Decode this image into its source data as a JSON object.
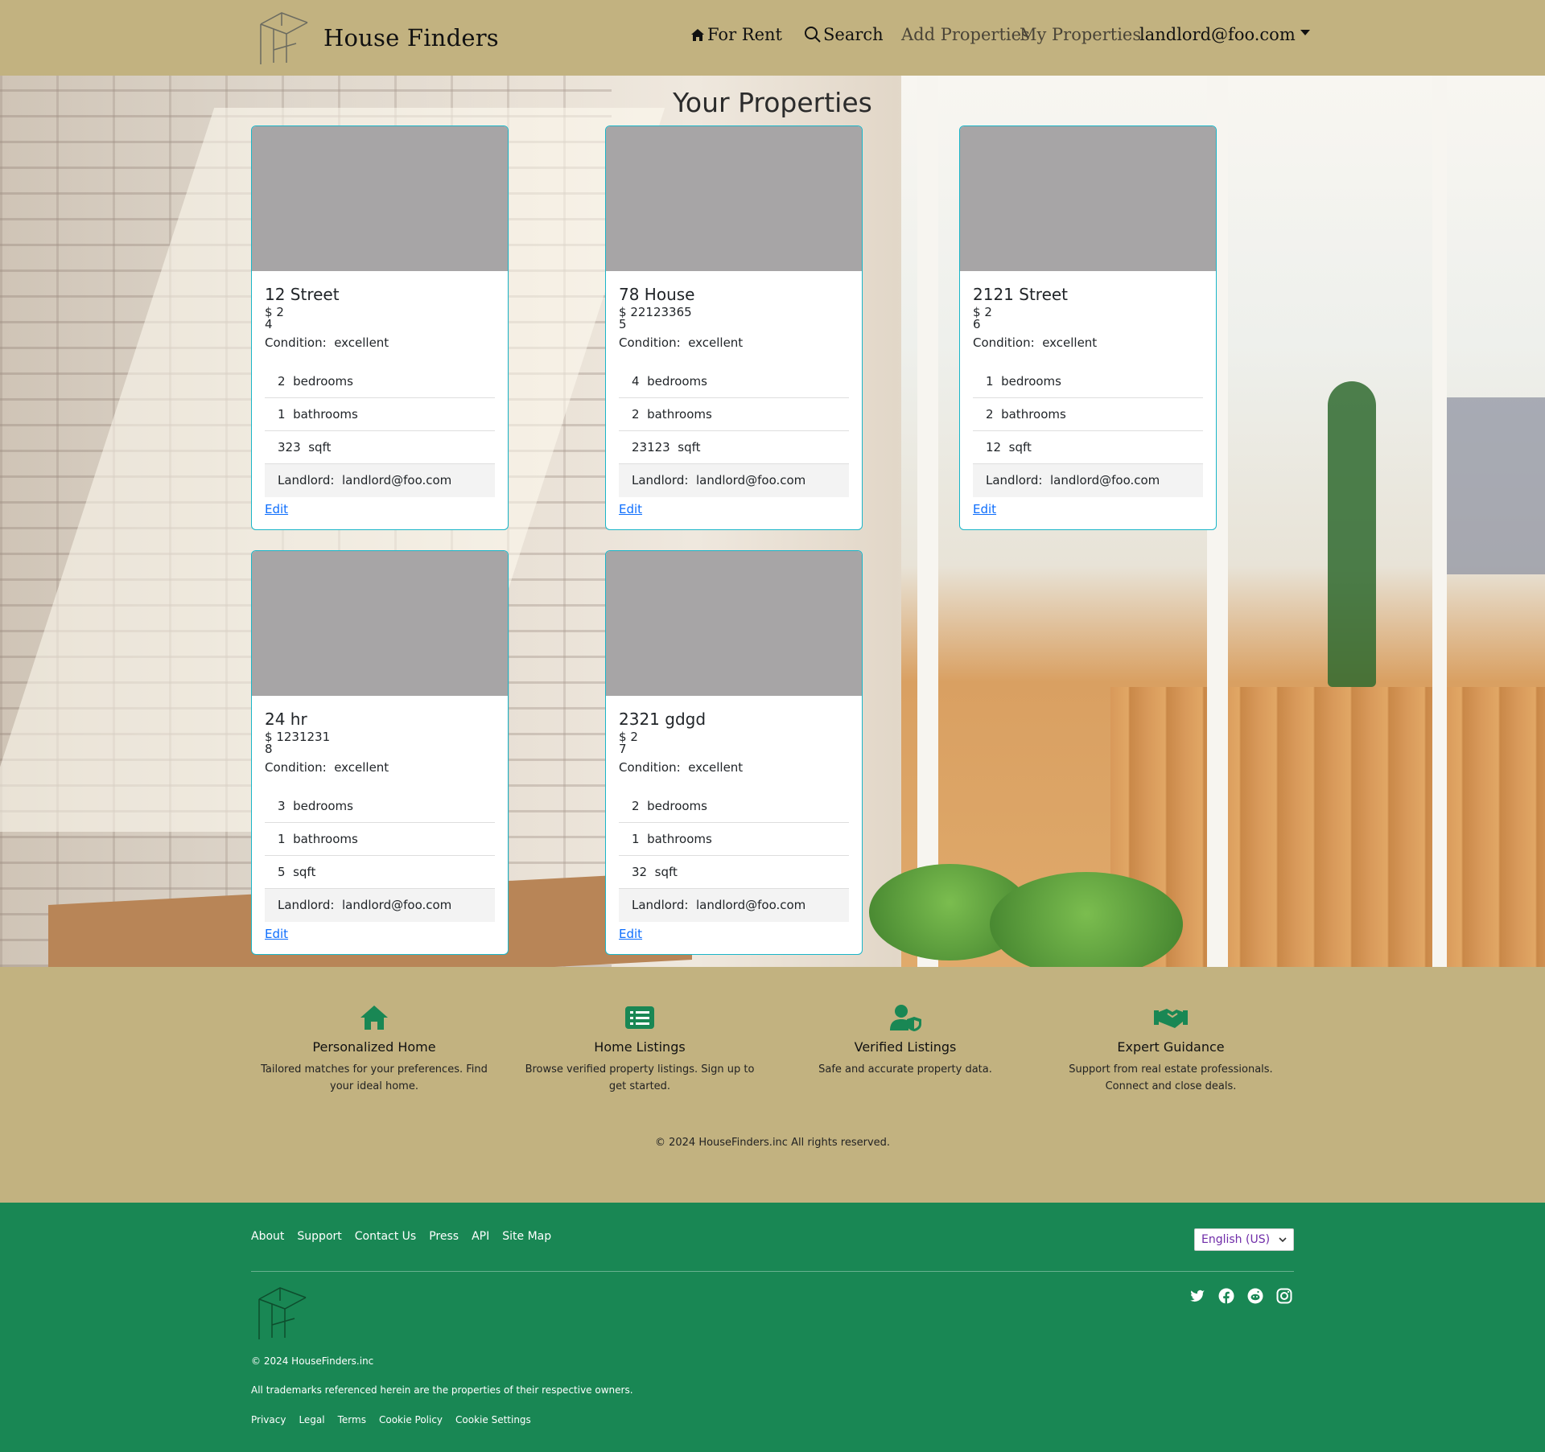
{
  "navbar": {
    "brand": "House Finders",
    "for_rent": "For Rent",
    "search": "Search",
    "add_properties": "Add Properties",
    "my_properties": "My Properties",
    "user": "landlord@foo.com"
  },
  "page": {
    "title": "Your Properties"
  },
  "labels": {
    "currency": "$",
    "condition": "Condition:",
    "bedrooms": "bedrooms",
    "bathrooms": "bathrooms",
    "sqft": "sqft",
    "landlord": "Landlord:",
    "edit": "Edit"
  },
  "properties": [
    {
      "title": "12 Street",
      "price": "2",
      "extra": "4",
      "condition": "excellent",
      "bedrooms": "2",
      "bathrooms": "1",
      "sqft": "323",
      "landlord": "landlord@foo.com"
    },
    {
      "title": "78 House",
      "price": "22123365",
      "extra": "5",
      "condition": "excellent",
      "bedrooms": "4",
      "bathrooms": "2",
      "sqft": "23123",
      "landlord": "landlord@foo.com"
    },
    {
      "title": "2121 Street",
      "price": "2",
      "extra": "6",
      "condition": "excellent",
      "bedrooms": "1",
      "bathrooms": "2",
      "sqft": "12",
      "landlord": "landlord@foo.com"
    },
    {
      "title": "24 hr",
      "price": "1231231",
      "extra": "8",
      "condition": "excellent",
      "bedrooms": "3",
      "bathrooms": "1",
      "sqft": "5",
      "landlord": "landlord@foo.com"
    },
    {
      "title": "2321 gdgd",
      "price": "2",
      "extra": "7",
      "condition": "excellent",
      "bedrooms": "2",
      "bathrooms": "1",
      "sqft": "32",
      "landlord": "landlord@foo.com"
    }
  ],
  "features": [
    {
      "icon": "house-icon",
      "title": "Personalized Home",
      "text": "Tailored matches for your preferences. Find your ideal home."
    },
    {
      "icon": "list-icon",
      "title": "Home Listings",
      "text": "Browse verified property listings. Sign up to get started."
    },
    {
      "icon": "user-shield-icon",
      "title": "Verified Listings",
      "text": "Safe and accurate property data."
    },
    {
      "icon": "handshake-icon",
      "title": "Expert Guidance",
      "text": "Support from real estate professionals. Connect and close deals."
    }
  ],
  "copyright_main": "© 2024 HouseFinders.inc All rights reserved.",
  "footer": {
    "links": [
      "About",
      "Support",
      "Contact Us",
      "Press",
      "API",
      "Site Map"
    ],
    "language": "English (US)",
    "social": [
      "twitter-icon",
      "facebook-icon",
      "reddit-icon",
      "instagram-icon"
    ],
    "copyright": "© 2024 HouseFinders.inc",
    "trademarks": "All trademarks referenced herein are the properties of their respective owners.",
    "bottom_links": [
      "Privacy",
      "Legal",
      "Terms",
      "Cookie Policy",
      "Cookie Settings"
    ]
  },
  "colors": {
    "navbar": "#c2b280",
    "footer": "#198754",
    "accent": "#198754",
    "card_border": "#1ab5c8",
    "link": "#0d6efd"
  }
}
